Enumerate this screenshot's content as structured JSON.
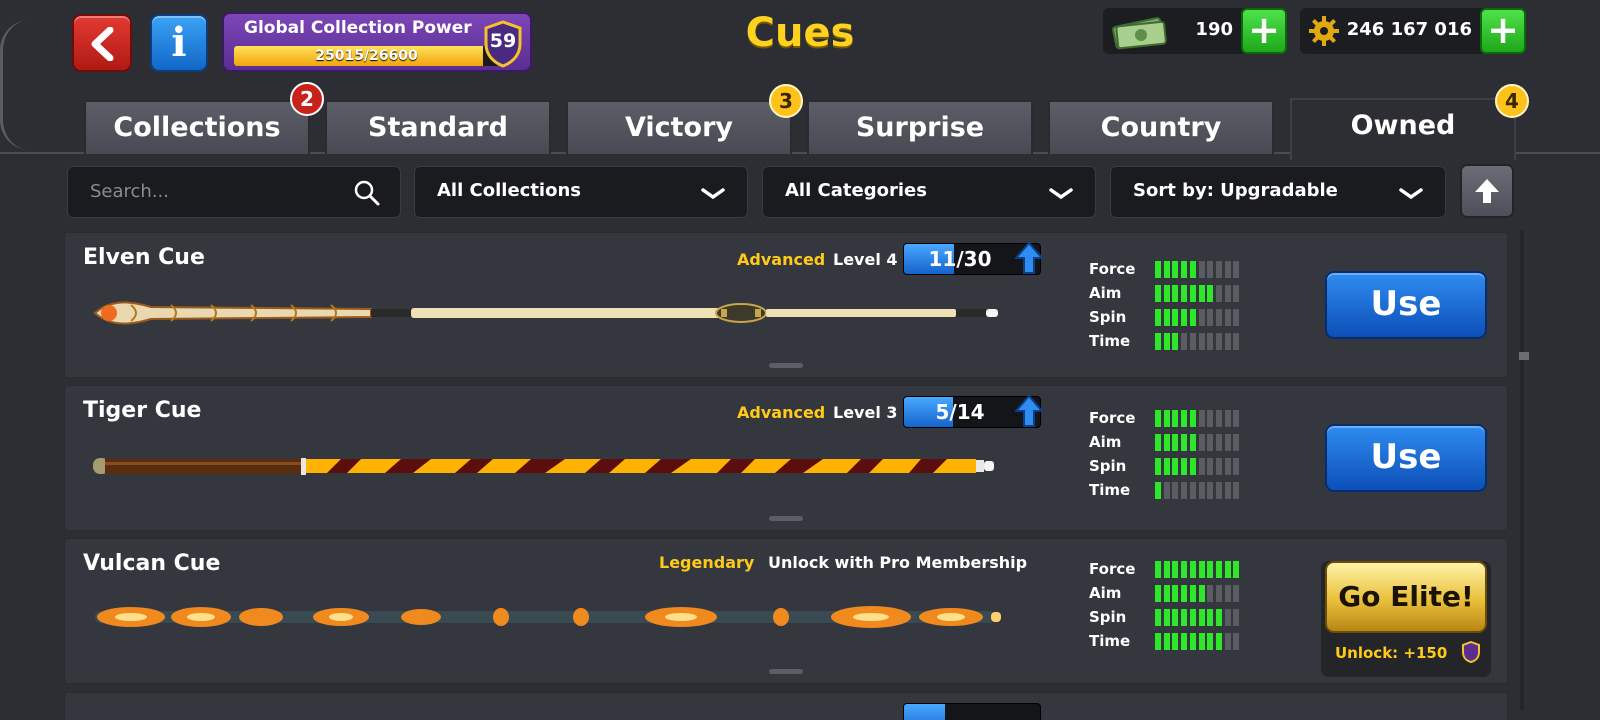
{
  "header": {
    "title": "Cues",
    "collection_power_label": "Global Collection Power",
    "collection_power_text": "25015/26600",
    "collection_power_progress": 0.94,
    "collection_level": "59",
    "cash_value": "190",
    "coins_value": "246 167 016"
  },
  "tabs": [
    {
      "label": "Collections",
      "badge": "2"
    },
    {
      "label": "Standard",
      "badge": ""
    },
    {
      "label": "Victory",
      "badge": "3"
    },
    {
      "label": "Surprise",
      "badge": ""
    },
    {
      "label": "Country",
      "badge": ""
    },
    {
      "label": "Owned",
      "badge": "4",
      "active": true
    }
  ],
  "filters": {
    "search_placeholder": "Search...",
    "collection": "All Collections",
    "category": "All Categories",
    "sort": "Sort by: Upgradable"
  },
  "cues": [
    {
      "name": "Elven Cue",
      "rarity": "Advanced",
      "level": "Level 4",
      "progress_text": "11/30",
      "progress": 0.367,
      "stats": {
        "force": 5,
        "aim": 7,
        "spin": 5,
        "time": 3
      },
      "action": "Use"
    },
    {
      "name": "Tiger Cue",
      "rarity": "Advanced",
      "level": "Level 3",
      "progress_text": "5/14",
      "progress": 0.357,
      "stats": {
        "force": 5,
        "aim": 5,
        "spin": 5,
        "time": 1
      },
      "action": "Use"
    },
    {
      "name": "Vulcan Cue",
      "rarity": "Legendary",
      "level": "Unlock with Pro Membership",
      "stats": {
        "force": 10,
        "aim": 6,
        "spin": 8,
        "time": 8
      },
      "action": "Go Elite!",
      "unlock_text": "Unlock: +150"
    }
  ],
  "stat_labels": {
    "force": "Force",
    "aim": "Aim",
    "spin": "Spin",
    "time": "Time"
  },
  "colors": {
    "accent_gold": "#ffcb18",
    "use_blue": "#1e6fdc",
    "stat_green": "#2ee62a",
    "power_purple": "#6a3aa5"
  }
}
